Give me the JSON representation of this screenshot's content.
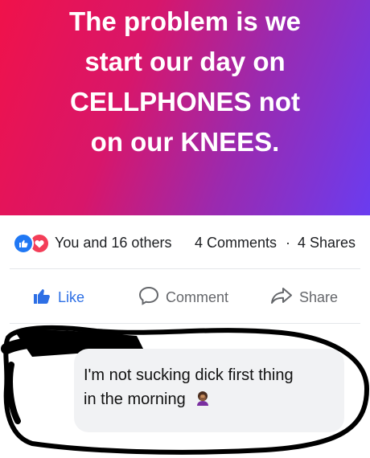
{
  "post": {
    "text": "The problem is we\nstart our day on\nCELLPHONES not\non our KNEES."
  },
  "stats": {
    "reactions_text": "You and 16 others",
    "comments_text": "4 Comments",
    "separator": "·",
    "shares_text": "4 Shares"
  },
  "actions": {
    "like_label": "Like",
    "comment_label": "Comment",
    "share_label": "Share"
  },
  "comment": {
    "text": "I'm not sucking dick first thing\nin the morning",
    "emoji": "woman-facepalming-emoji"
  },
  "colors": {
    "like_blue": "#2078f4",
    "love_red": "#f33e58",
    "marker_black": "#000000"
  }
}
